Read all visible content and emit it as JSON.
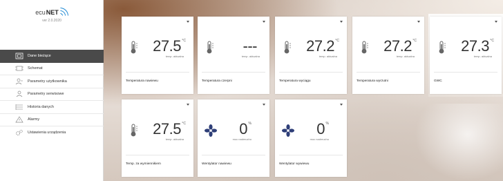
{
  "app": {
    "brand_prefix": "ecu",
    "brand_name": "NET",
    "version": "ver 2.0.2020"
  },
  "sidebar": {
    "items": [
      {
        "label": "Dane bieżące",
        "icon": "home-icon",
        "active": true
      },
      {
        "label": "Schemat",
        "icon": "schema-icon",
        "active": false
      },
      {
        "label": "Parametry użytkownika",
        "icon": "user-params-icon",
        "active": false
      },
      {
        "label": "Parametry serwisowe",
        "icon": "service-params-icon",
        "active": false
      },
      {
        "label": "Historia danych",
        "icon": "history-icon",
        "active": false
      },
      {
        "label": "Alarmy",
        "icon": "alarm-icon",
        "active": false
      },
      {
        "label": "Ustawienia urządzenia",
        "icon": "settings-icon",
        "active": false
      }
    ]
  },
  "tiles": [
    {
      "kind": "temp",
      "value": "27.5",
      "unit": "°C",
      "sub": "temp. aktualna",
      "label": "Temperatura nawiewu"
    },
    {
      "kind": "temp",
      "value": "---",
      "unit": "",
      "sub": "temp. aktualna",
      "label": "Temperatura czerpni"
    },
    {
      "kind": "temp",
      "value": "27.2",
      "unit": "°C",
      "sub": "temp. aktualna",
      "label": "Temperatura wyciągu"
    },
    {
      "kind": "temp",
      "value": "27.2",
      "unit": "°C",
      "sub": "temp. aktualna",
      "label": "Temperatura wyrzutni"
    },
    {
      "kind": "temp",
      "value": "27.3",
      "unit": "°C",
      "sub": "temp. aktualna",
      "label": "GWC"
    },
    {
      "kind": "temp",
      "value": "27.5",
      "unit": "°C",
      "sub": "temp. aktualna",
      "label": "Temp. za wymiennikiem"
    },
    {
      "kind": "fan",
      "value": "0",
      "unit": "%",
      "sub": "moc nadmuchu",
      "label": "Wentylator nawiewu"
    },
    {
      "kind": "fan",
      "value": "0",
      "unit": "%",
      "sub": "moc nadmuchu",
      "label": "Wentylator wywiewu"
    }
  ],
  "colors": {
    "accent": "#1f8ad4",
    "active_menu_bg": "#4a4a4a"
  }
}
